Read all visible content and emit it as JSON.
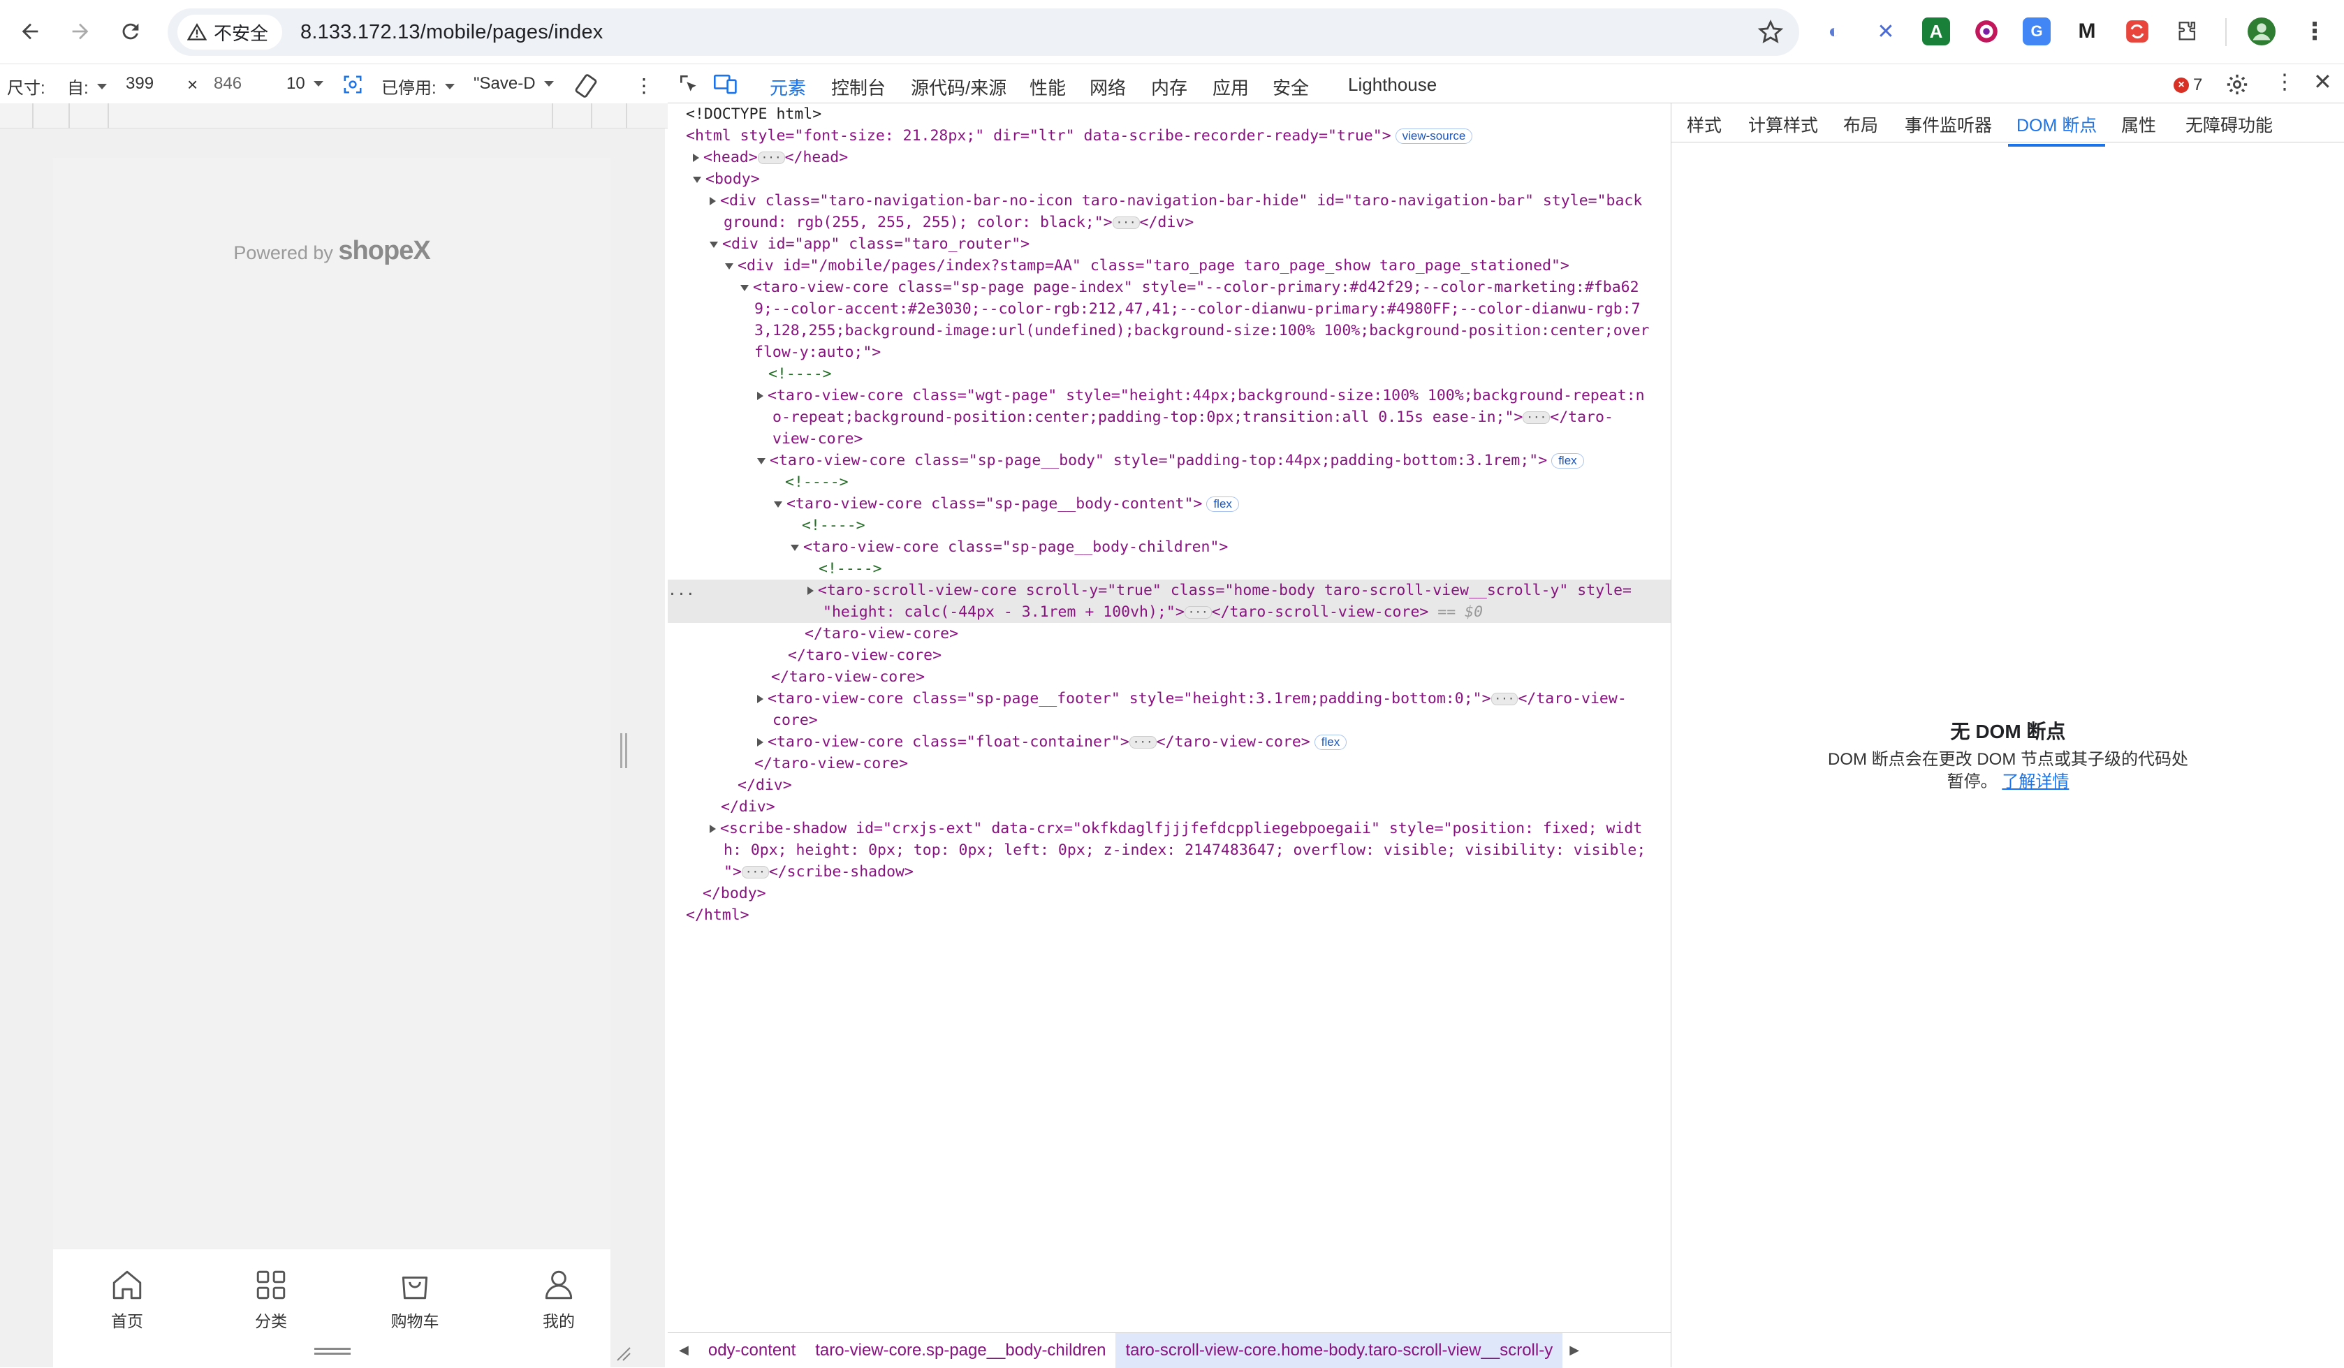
{
  "browser": {
    "security_label": "不安全",
    "url": "8.133.172.13/mobile/pages/index"
  },
  "device_toolbar": {
    "size_label": "尺寸:",
    "preset": "自:",
    "width": "399",
    "times": "×",
    "height": "846",
    "zoom": "10",
    "throttle": "已停用:",
    "save_label": "\"Save-D"
  },
  "app": {
    "powered_prefix": "Powered by",
    "powered_brand": "shopeX",
    "tabs": [
      {
        "label": "首页",
        "icon": "home-icon"
      },
      {
        "label": "分类",
        "icon": "grid-icon"
      },
      {
        "label": "购物车",
        "icon": "cart-bag-icon"
      },
      {
        "label": "我的",
        "icon": "user-icon"
      }
    ]
  },
  "devtools": {
    "tabs": [
      "元素",
      "控制台",
      "源代码/来源",
      "性能",
      "网络",
      "内存",
      "应用",
      "安全",
      "Lighthouse"
    ],
    "active_tab": "元素",
    "error_count": "7",
    "breadcrumbs": [
      "ody-content",
      "taro-view-core.sp-page__body-children",
      "taro-scroll-view-core.home-body.taro-scroll-view__scroll-y"
    ],
    "sidebar_tabs": [
      "样式",
      "计算样式",
      "布局",
      "事件监听器",
      "DOM 断点",
      "属性",
      "无障碍功能"
    ],
    "sidebar_active": "DOM 断点",
    "empty_title": "无 DOM 断点",
    "empty_desc": "DOM 断点会在更改 DOM 节点或其子级的代码处暂停。",
    "learn_more": "了解详情",
    "dom": {
      "doctype": "<!DOCTYPE html>",
      "html_open": "<html style=\"font-size: 21.28px;\" dir=\"ltr\" data-scribe-recorder-ready=\"true\">",
      "view_source": "view-source",
      "head": "<head>",
      "head_close": "</head>",
      "body": "<body>",
      "nav_1": "<div class=\"taro-navigation-bar-no-icon taro-navigation-bar-hide\" id=\"taro-navigation-bar\" style=\"back",
      "nav_2": "ground: rgb(255, 255, 255); color: black;\">",
      "div_close": "</div>",
      "app": "<div id=\"app\" class=\"taro_router\">",
      "page": "<div id=\"/mobile/pages/index?stamp=AA\" class=\"taro_page taro_page_show taro_page_stationed\">",
      "sp_1": "<taro-view-core class=\"sp-page page-index\" style=\"--color-primary:#d42f29;--color-marketing:#fba62",
      "sp_2": "9;--color-accent:#2e3030;--color-rgb:212,47,41;--color-dianwu-primary:#4980FF;--color-dianwu-rgb:7",
      "sp_3": "3,128,255;background-image:url(undefined);background-size:100% 100%;background-position:center;over",
      "sp_4": "flow-y:auto;\">",
      "comment": "<!---->",
      "wgt_1": "<taro-view-core class=\"wgt-page\" style=\"height:44px;background-size:100% 100%;background-repeat:n",
      "wgt_2": "o-repeat;background-position:center;padding-top:0px;transition:all 0.15s ease-in;\">",
      "wgt_close_a": "</taro-",
      "wgt_3": "view-core>",
      "body_core": "<taro-view-core class=\"sp-page__body\" style=\"padding-top:44px;padding-bottom:3.1rem;\">",
      "flex": "flex",
      "body_content": "<taro-view-core class=\"sp-page__body-content\">",
      "body_children": "<taro-view-core class=\"sp-page__body-children\">",
      "scroll_1": "<taro-scroll-view-core scroll-y=\"true\" class=\"home-body taro-scroll-view__scroll-y\" style=",
      "scroll_2": "\"height: calc(-44px - 3.1rem + 100vh);\">",
      "scroll_close": "</taro-scroll-view-core>",
      "dollar": " == $0",
      "tvc_close": "</taro-view-core>",
      "footer_1": "<taro-view-core class=\"sp-page__footer\" style=\"height:3.1rem;padding-bottom:0;\">",
      "footer_close": "</taro-view-",
      "footer_2": "core>",
      "float": "<taro-view-core class=\"float-container\">",
      "scribe_1": "<scribe-shadow id=\"crxjs-ext\" data-crx=\"okfkdaglfjjjfefdcppliegebpoegaii\" style=\"position: fixed; widt",
      "scribe_2": "h: 0px; height: 0px; top: 0px; left: 0px; z-index: 2147483647; overflow: visible; visibility: visible;",
      "scribe_3": "\">",
      "scribe_close": "</scribe-shadow>",
      "body_close": "</body>",
      "html_close": "</html>",
      "dots": "..."
    }
  }
}
